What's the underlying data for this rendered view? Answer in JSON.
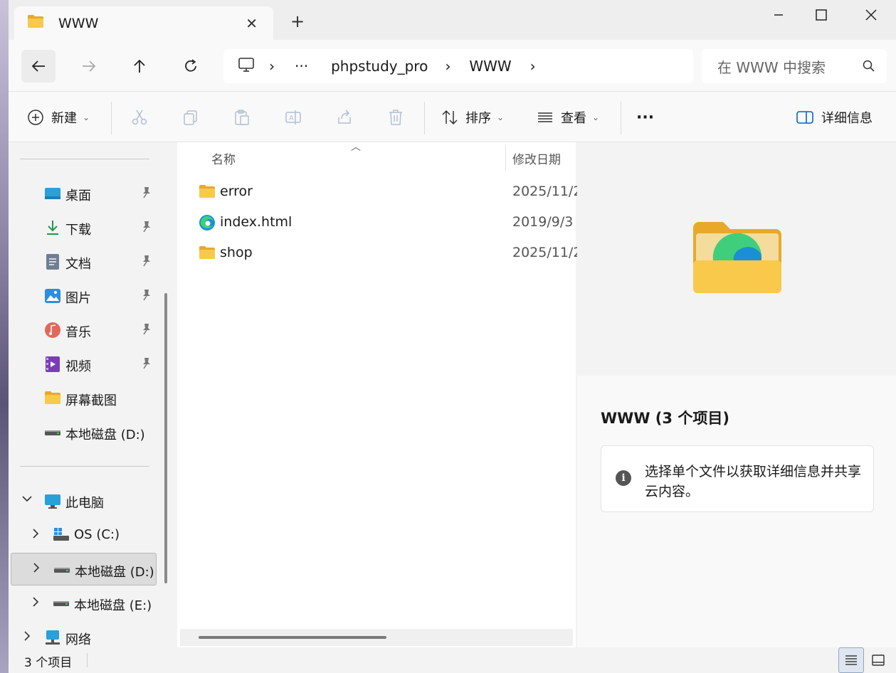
{
  "tab": {
    "title": "WWW",
    "close": "✕",
    "new_tab": "+"
  },
  "window_controls": {
    "minimize": "minimize-icon",
    "maximize": "maximize-icon",
    "close": "close-icon"
  },
  "nav": {
    "back": "back-arrow-icon",
    "forward": "forward-arrow-icon",
    "up": "up-arrow-icon",
    "refresh": "refresh-icon"
  },
  "address": {
    "sep": "›",
    "ellipsis": "···",
    "crumbs": [
      "phpstudy_pro",
      "WWW"
    ]
  },
  "search": {
    "placeholder": "在 WWW 中搜索"
  },
  "toolbar": {
    "new_label": "新建",
    "sort_label": "排序",
    "view_label": "查看",
    "more_label": "···",
    "details_label": "详细信息"
  },
  "sidebar": {
    "quick_access": [
      {
        "label": "桌面",
        "icon": "desktop-icon"
      },
      {
        "label": "下载",
        "icon": "download-icon"
      },
      {
        "label": "文档",
        "icon": "document-icon"
      },
      {
        "label": "图片",
        "icon": "pictures-icon"
      },
      {
        "label": "音乐",
        "icon": "music-icon"
      },
      {
        "label": "视频",
        "icon": "video-icon"
      },
      {
        "label": "屏幕截图",
        "icon": "folder-icon"
      },
      {
        "label": "本地磁盘 (D:)",
        "icon": "drive-icon"
      }
    ],
    "this_pc": "此电脑",
    "drives": [
      "OS (C:)",
      "本地磁盘 (D:)",
      "本地磁盘 (E:)"
    ],
    "network": "网络"
  },
  "columns": {
    "name": "名称",
    "modified": "修改日期"
  },
  "files": [
    {
      "name": "error",
      "date": "2025/11/2",
      "icon": "folder-icon"
    },
    {
      "name": "index.html",
      "date": "2019/9/3",
      "icon": "edge-icon"
    },
    {
      "name": "shop",
      "date": "2025/11/2",
      "icon": "folder-icon"
    }
  ],
  "details": {
    "title": "WWW (3 个项目)",
    "message": "选择单个文件以获取详细信息并共享云内容。"
  },
  "status": {
    "count": "3 个项目"
  },
  "colors": {
    "folder": "#f5c542",
    "accent": "#0067c0",
    "selection": "#dcdcdc"
  }
}
